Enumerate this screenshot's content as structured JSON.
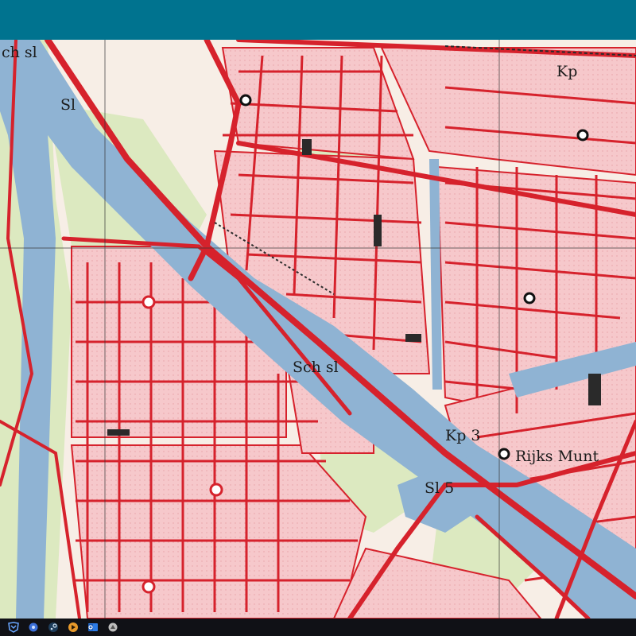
{
  "window": {
    "title_bar_color": "#00738f"
  },
  "map": {
    "colors": {
      "water": "#8fb3d3",
      "road": "#d6222c",
      "block_fill": "#f6c8cb",
      "block_stroke": "#d6222c",
      "green": "#dce9c0",
      "paper": "#f7eee6",
      "building": "#d6222c",
      "gridline": "#333333"
    },
    "labels": {
      "sch_sl_top": "ch sl",
      "sl_left": "Sl",
      "kp_top_right": "Kp",
      "sch_sl_center": "Sch sl",
      "kp_center": "Kp 3",
      "rijks_munt": "Rijks Munt",
      "sl_bottom": "Sl 5"
    }
  },
  "taskbar": {
    "icons": [
      {
        "name": "start-icon",
        "color": "#1e90ff"
      },
      {
        "name": "search-icon",
        "color": "#8fb4ff"
      },
      {
        "name": "steam-icon",
        "color": "#8ab4d8"
      },
      {
        "name": "media-icon",
        "color": "#e89a2b"
      },
      {
        "name": "outlook-icon",
        "color": "#2c7be5"
      },
      {
        "name": "app-icon",
        "color": "#cfcfcf"
      }
    ]
  }
}
